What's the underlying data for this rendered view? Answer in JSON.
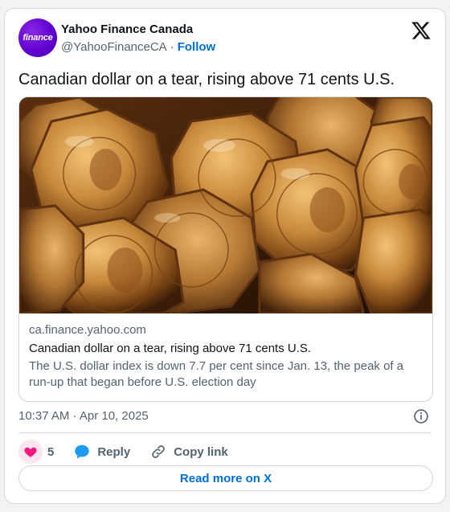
{
  "author": {
    "name": "Yahoo Finance Canada",
    "handle": "@YahooFinanceCA",
    "separator": "·",
    "follow_label": "Follow",
    "avatar_text": "finance"
  },
  "tweet": {
    "text": "Canadian dollar on a tear, rising above 71 cents U.S."
  },
  "link_card": {
    "image_icon": "canadian-loonie-coins-image",
    "domain": "ca.finance.yahoo.com",
    "title": "Canadian dollar on a tear, rising above 71 cents U.S.",
    "description": "The U.S. dollar index is down 7.7 per cent since Jan. 13, the peak of a run-up that began before U.S. election day"
  },
  "timestamp": "10:37 AM · Apr 10, 2025",
  "actions": {
    "like_count": "5",
    "reply_label": "Reply",
    "copy_label": "Copy link"
  },
  "read_more_label": "Read more on X",
  "colors": {
    "accent": "#006fd6",
    "like": "#f91880",
    "brand": "#6001d2",
    "muted": "#536471",
    "border": "#cfd9de"
  }
}
